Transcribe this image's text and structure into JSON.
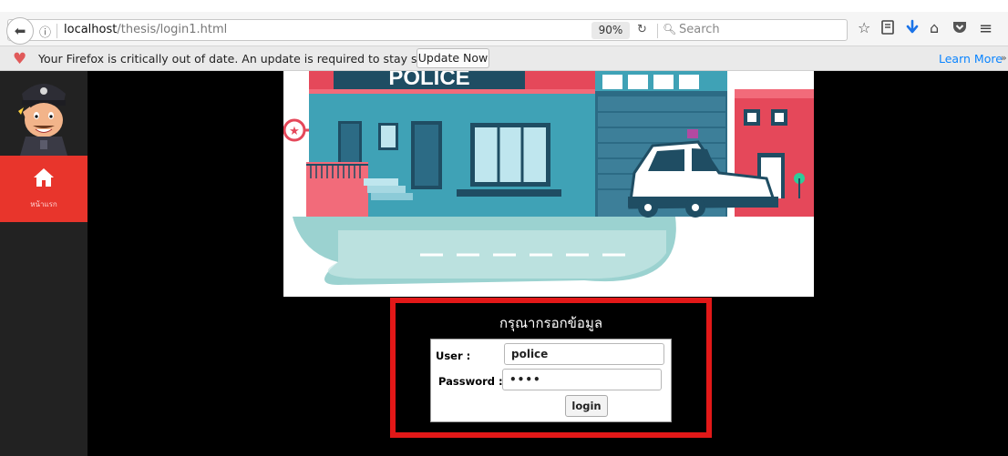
{
  "browser": {
    "url_host": "localhost",
    "url_path": "/thesis/login1.html",
    "zoom": "90%",
    "search_placeholder": "Search",
    "icons": [
      "back-icon",
      "info-icon",
      "reload-icon",
      "search-icon",
      "bookmark-star-icon",
      "reading-list-icon",
      "download-icon",
      "home-icon",
      "pocket-icon",
      "menu-icon"
    ]
  },
  "notification": {
    "message": "Your Firefox is critically out of date. An update is required to stay secure.",
    "update_label": "Update Now",
    "learn_more_label": "Learn More",
    "accent_color": "#e05a5a"
  },
  "sidebar": {
    "home_label": "หน้าแรก",
    "active_color": "#e8352c"
  },
  "hero": {
    "sign_text": "POLICE"
  },
  "login": {
    "title": "กรุณากรอกข้อมูล",
    "user_label": "User :",
    "user_value": "police",
    "password_label": "Password :",
    "password_value": "••••",
    "button_label": "login",
    "highlight_color": "#e21818"
  }
}
